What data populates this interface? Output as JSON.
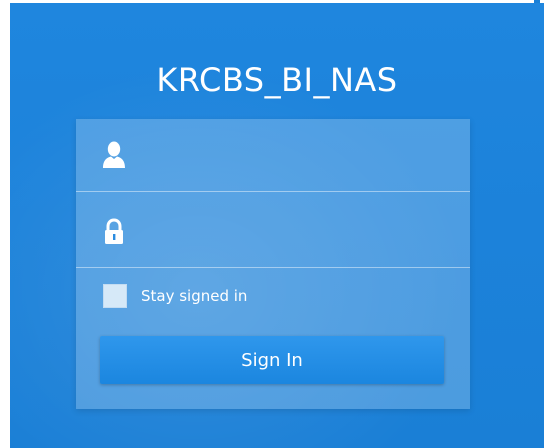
{
  "login": {
    "title": "KRCBS_BI_NAS",
    "username": {
      "value": "",
      "placeholder": "",
      "icon": "user-icon"
    },
    "password": {
      "value": "",
      "placeholder": "",
      "icon": "lock-icon"
    },
    "stay_signed_in": {
      "label": "Stay signed in",
      "checked": false
    },
    "sign_in_label": "Sign In"
  },
  "colors": {
    "background": "#1c82da",
    "panel": "#5aa8e8",
    "button": "#2490e6",
    "text": "#ffffff"
  }
}
